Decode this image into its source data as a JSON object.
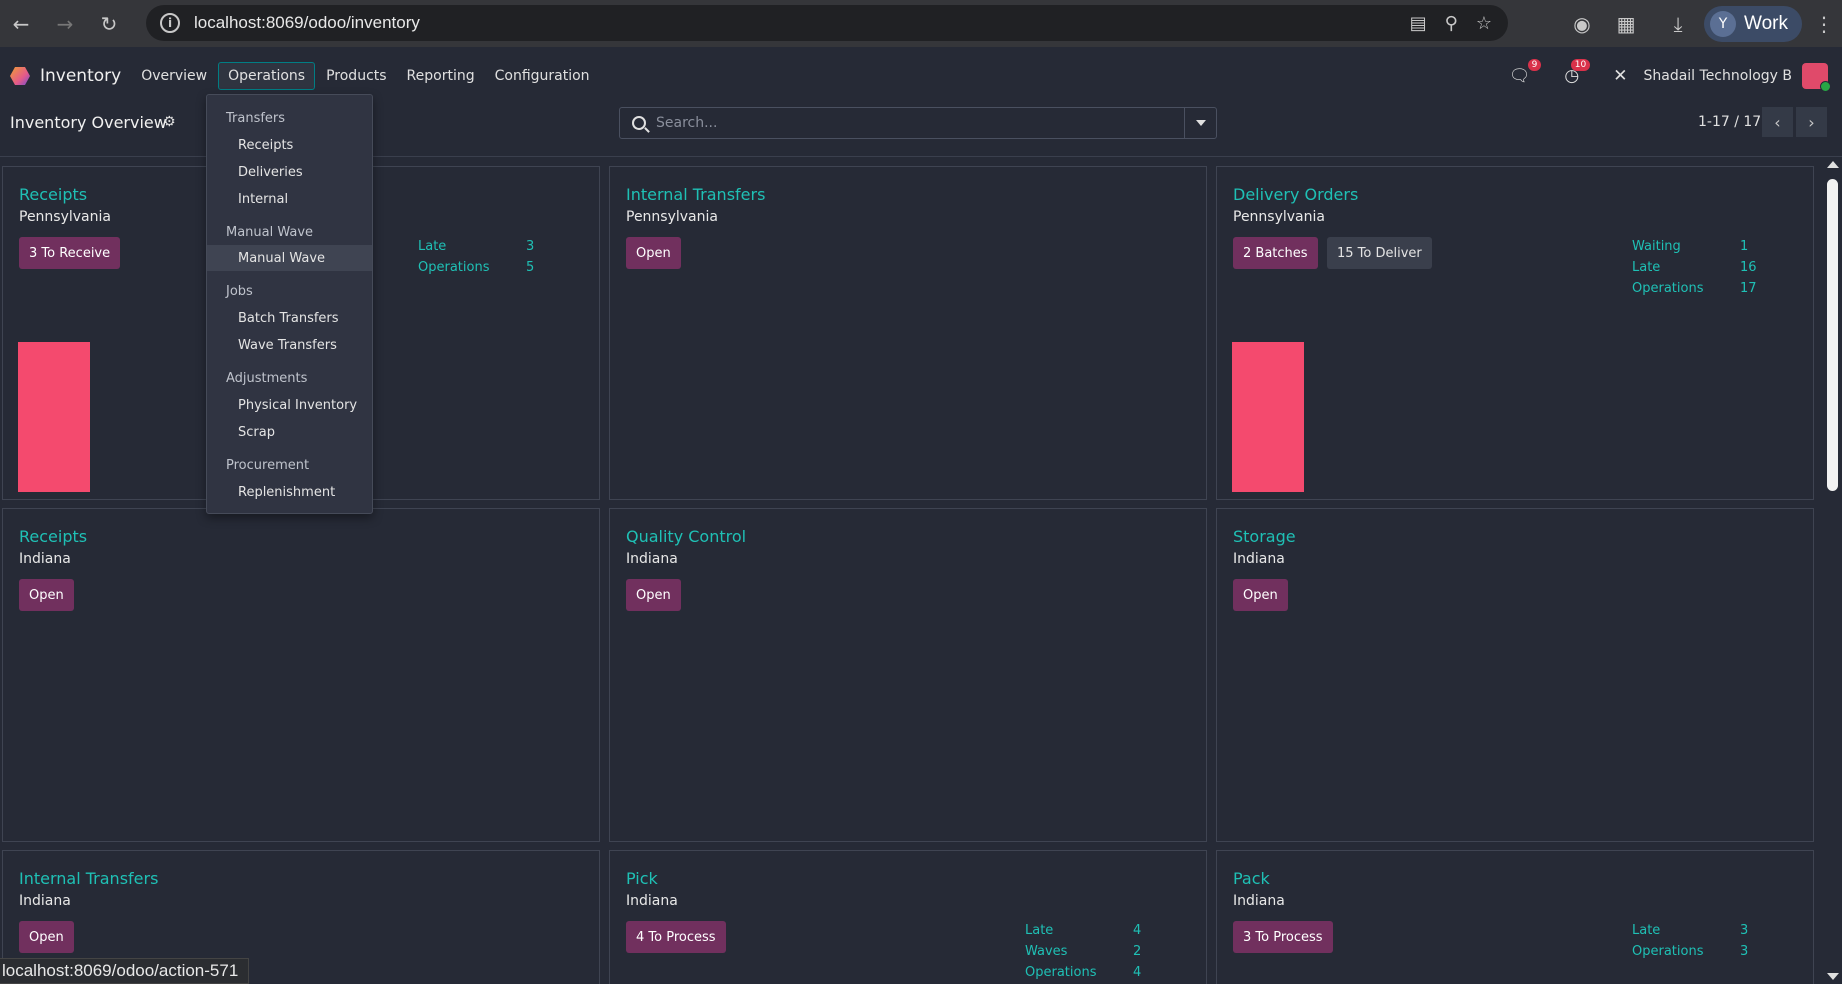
{
  "browser": {
    "url": "localhost:8069/odoo/inventory",
    "profile_initial": "Y",
    "profile_label": "Work",
    "status_url": "localhost:8069/odoo/action-571"
  },
  "nav": {
    "app_name": "Inventory",
    "items": [
      "Overview",
      "Operations",
      "Products",
      "Reporting",
      "Configuration"
    ],
    "messages_badge": "9",
    "activities_badge": "10",
    "company": "Shadail Technology B"
  },
  "control": {
    "title": "Inventory Overview",
    "search_placeholder": "Search...",
    "pager": "1-17 / 17"
  },
  "dropdown": {
    "sections": [
      {
        "header": "Transfers",
        "items": [
          "Receipts",
          "Deliveries",
          "Internal"
        ]
      },
      {
        "header": "Manual Wave",
        "items": [
          "Manual Wave"
        ]
      },
      {
        "header": "Jobs",
        "items": [
          "Batch Transfers",
          "Wave Transfers"
        ]
      },
      {
        "header": "Adjustments",
        "items": [
          "Physical Inventory",
          "Scrap"
        ]
      },
      {
        "header": "Procurement",
        "items": [
          "Replenishment"
        ]
      }
    ]
  },
  "cards": [
    {
      "title": "Receipts",
      "subtitle": "Pennsylvania",
      "primary": "3 To Receive",
      "stats": [
        {
          "label": "Late",
          "value": "3"
        },
        {
          "label": "Operations",
          "value": "5"
        }
      ]
    },
    {
      "title": "Internal Transfers",
      "subtitle": "Pennsylvania",
      "primary": "Open"
    },
    {
      "title": "Delivery Orders",
      "subtitle": "Pennsylvania",
      "primary": "2 Batches",
      "secondary": "15 To Deliver",
      "stats": [
        {
          "label": "Waiting",
          "value": "1"
        },
        {
          "label": "Late",
          "value": "16"
        },
        {
          "label": "Operations",
          "value": "17"
        }
      ]
    },
    {
      "title": "Receipts",
      "subtitle": "Indiana",
      "primary": "Open"
    },
    {
      "title": "Quality Control",
      "subtitle": "Indiana",
      "primary": "Open"
    },
    {
      "title": "Storage",
      "subtitle": "Indiana",
      "primary": "Open"
    },
    {
      "title": "Internal Transfers",
      "subtitle": "Indiana",
      "primary": "Open"
    },
    {
      "title": "Pick",
      "subtitle": "Indiana",
      "primary": "4 To Process",
      "stats": [
        {
          "label": "Late",
          "value": "4"
        },
        {
          "label": "Waves",
          "value": "2"
        },
        {
          "label": "Operations",
          "value": "4"
        }
      ]
    },
    {
      "title": "Pack",
      "subtitle": "Indiana",
      "primary": "3 To Process",
      "stats": [
        {
          "label": "Late",
          "value": "3"
        },
        {
          "label": "Operations",
          "value": "3"
        }
      ]
    }
  ],
  "colors": {
    "accent": "#1fc0b5",
    "primary_button": "#71305e",
    "graph_bar": "#f44a6e"
  }
}
